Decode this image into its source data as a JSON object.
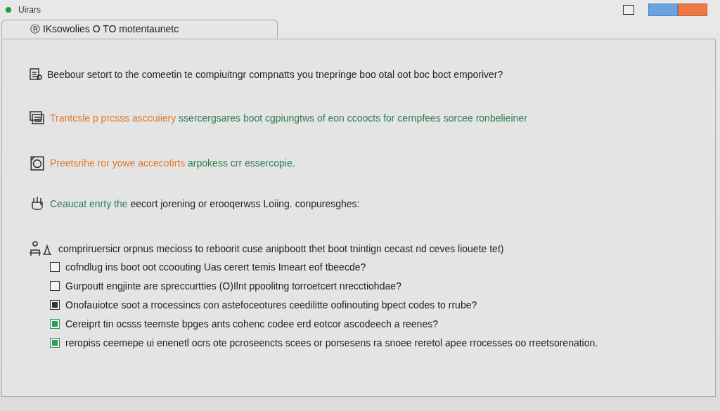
{
  "window": {
    "title": "Uirars"
  },
  "tab": {
    "label": "Ⓡ IKsowolies O TO motentaunetc"
  },
  "items": [
    {
      "kind": "document",
      "segments": [
        {
          "text": "Beebour setort to the comeetin te compiuitngr compnatts you tnepringe boo otal oot boc boct emporiver?",
          "color": "#222222"
        }
      ]
    },
    {
      "kind": "stack",
      "segments": [
        {
          "text": "Trantcsle p prcsss asccuiiery",
          "color": "#e07a2e"
        },
        {
          "text": "ssercergsares boot cgpiungtws of eon ccoocts for cernpfees sorcee ronbelieiner",
          "color": "#2e7d4f"
        }
      ]
    },
    {
      "kind": "camera",
      "segments": [
        {
          "text": "Preetsrihe ror yowe accecotirts",
          "color": "#e07a2e"
        },
        {
          "text": "arpokess crr essercopie.",
          "color": "#2e7d4f"
        }
      ]
    },
    {
      "kind": "plug",
      "segments": [
        {
          "text": "Ceaucat enrty the",
          "color": "#2e7d4f"
        },
        {
          "text": "eecort jorening or erooqerwss Loiing. conpuresghes:",
          "color": "#222222"
        }
      ]
    },
    {
      "kind": "person",
      "segments": [
        {
          "text": "compriruersicr orpnus mecioss to reboorit cuse anipboott thet boot tnintign cecast nd ceves liouete tet)",
          "color": "#222222"
        }
      ]
    }
  ],
  "checklist": [
    {
      "label": "cofndlug ins boot oot ccoouting Uas cerert temis Imeart eof tbeecde?",
      "checked": false,
      "color": "#333333"
    },
    {
      "label": "Gurpoutt engjinte are spreccurtties (O)Ilnt ppoolitng torroetcert nrecctiohdae?",
      "checked": false,
      "color": "#333333"
    },
    {
      "label": "Onofauiotce soot a rrocessincs con astefoceotures ceedilitte oofinouting bpect codes to rrube?",
      "checked": true,
      "color": "#333333"
    },
    {
      "label": "Cereiprt tin ocsss teemste bpges ants cohenc codee erd eotcor ascodeech a reenes?",
      "checked": true,
      "color": "#2e9a5a"
    },
    {
      "label": "reropiss ceemepe ui enenetl ocrs ote pcroseencts scees or porsesens ra snoee reretol apee rrocesses oo rreetsorenation.",
      "checked": true,
      "color": "#2e9a5a"
    }
  ]
}
